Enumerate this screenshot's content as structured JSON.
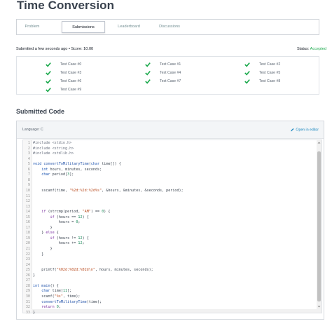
{
  "page": {
    "title": "Time Conversion"
  },
  "tabs": [
    {
      "label": "Problem",
      "active": false
    },
    {
      "label": "Submissions",
      "active": true
    },
    {
      "label": "Leaderboard",
      "active": false
    },
    {
      "label": "Discussions",
      "active": false
    }
  ],
  "submission": {
    "meta": "Submitted a few seconds ago • Score: 10.00",
    "status_label": "Status:",
    "status_value": "Accepted",
    "status_color": "#1ba94c"
  },
  "test_cases": [
    "Test Case #0",
    "Test Case #1",
    "Test Case #2",
    "Test Case #3",
    "Test Case #4",
    "Test Case #5",
    "Test Case #6",
    "Test Case #7",
    "Test Case #8",
    "Test Case #9"
  ],
  "submitted_code": {
    "heading": "Submitted Code",
    "language": "Language: C",
    "open_in_editor": "Open in editor",
    "lines": [
      "#include <stdio.h>",
      "#include <string.h>",
      "#include <stdlib.h>",
      "",
      "void convertToMilitaryTime(char time[]) {",
      "    int hours, minutes, seconds;",
      "    char period[3];",
      "",
      "",
      "    sscanf(time, \"%2d:%2d:%2d%s\", &hours, &minutes, &seconds, period);",
      "",
      "",
      "",
      "    if (strcmp(period, \"AM\") == 0) {",
      "        if (hours == 12) {",
      "            hours = 0;",
      "        }",
      "    } else {",
      "        if (hours != 12) {",
      "            hours += 12;",
      "        }",
      "    }",
      "",
      "",
      "    printf(\"%02d:%02d:%02d\\n\", hours, minutes, seconds);",
      "}",
      "",
      "int main() {",
      "    char time[11];",
      "    scanf(\"%s\", time);",
      "    convertToMilitaryTime(time);",
      "    return 0;",
      "}"
    ]
  }
}
